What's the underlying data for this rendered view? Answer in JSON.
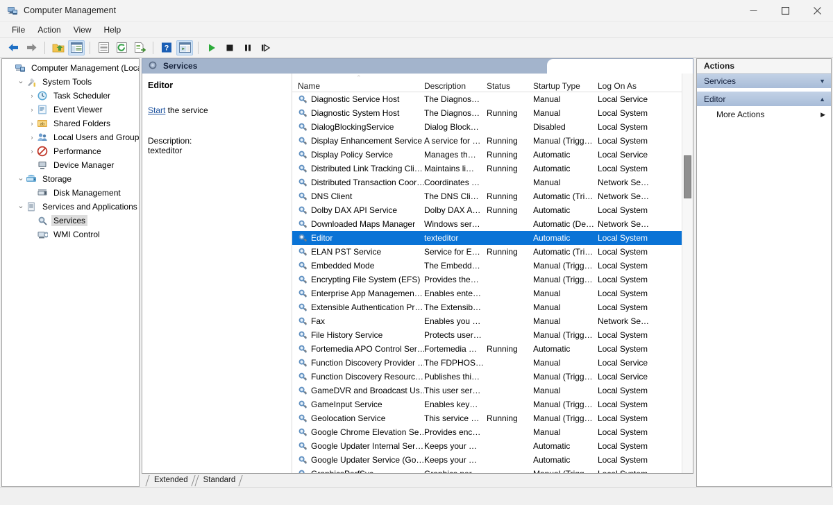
{
  "window": {
    "title": "Computer Management",
    "icon": "computer-management-icon",
    "controls": {
      "minimize": "–",
      "maximize": "❐",
      "close": "✕"
    }
  },
  "menubar": {
    "items": [
      "File",
      "Action",
      "View",
      "Help"
    ]
  },
  "toolbar": {
    "buttons": [
      {
        "name": "back-arrow-icon",
        "glyph": "←"
      },
      {
        "name": "forward-arrow-icon",
        "glyph": "→"
      },
      {
        "name": "up-one-level-icon",
        "glyph": "folder-up"
      },
      {
        "name": "show-hide-console-tree-icon",
        "glyph": "tree",
        "pressed": true
      },
      {
        "name": "properties-icon",
        "glyph": "props"
      },
      {
        "name": "refresh-icon",
        "glyph": "refresh"
      },
      {
        "name": "export-list-icon",
        "glyph": "export"
      },
      {
        "name": "help-icon",
        "glyph": "?"
      },
      {
        "name": "show-hide-action-pane-icon",
        "glyph": "actionpane",
        "pressed": true
      },
      {
        "name": "start-service-icon",
        "glyph": "▶"
      },
      {
        "name": "stop-service-icon",
        "glyph": "■"
      },
      {
        "name": "pause-service-icon",
        "glyph": "‖"
      },
      {
        "name": "restart-service-icon",
        "glyph": "▮▶"
      }
    ]
  },
  "sidebar": {
    "items": [
      {
        "label": "Computer Management (Local)",
        "indent": 0,
        "twist": "",
        "icon": "computer-icon",
        "selected": false
      },
      {
        "label": "System Tools",
        "indent": 1,
        "twist": "⌄",
        "icon": "system-tools-icon",
        "selected": false
      },
      {
        "label": "Task Scheduler",
        "indent": 2,
        "twist": "›",
        "icon": "task-scheduler-icon",
        "selected": false
      },
      {
        "label": "Event Viewer",
        "indent": 2,
        "twist": "›",
        "icon": "event-viewer-icon",
        "selected": false
      },
      {
        "label": "Shared Folders",
        "indent": 2,
        "twist": "›",
        "icon": "shared-folders-icon",
        "selected": false
      },
      {
        "label": "Local Users and Groups",
        "indent": 2,
        "twist": "›",
        "icon": "local-users-icon",
        "selected": false
      },
      {
        "label": "Performance",
        "indent": 2,
        "twist": "›",
        "icon": "performance-icon",
        "selected": false
      },
      {
        "label": "Device Manager",
        "indent": 2,
        "twist": "",
        "icon": "device-manager-icon",
        "selected": false
      },
      {
        "label": "Storage",
        "indent": 1,
        "twist": "⌄",
        "icon": "storage-icon",
        "selected": false
      },
      {
        "label": "Disk Management",
        "indent": 2,
        "twist": "",
        "icon": "disk-management-icon",
        "selected": false
      },
      {
        "label": "Services and Applications",
        "indent": 1,
        "twist": "⌄",
        "icon": "services-apps-icon",
        "selected": false
      },
      {
        "label": "Services",
        "indent": 2,
        "twist": "",
        "icon": "services-icon",
        "selected": true
      },
      {
        "label": "WMI Control",
        "indent": 2,
        "twist": "",
        "icon": "wmi-control-icon",
        "selected": false
      }
    ]
  },
  "snapin": {
    "header": "Services",
    "icon": "services-icon"
  },
  "details": {
    "title": "Editor",
    "link": "Start",
    "link_suffix": " the service",
    "description_label": "Description:",
    "description_value": "texteditor"
  },
  "table": {
    "columns": [
      "Name",
      "Description",
      "Status",
      "Startup Type",
      "Log On As"
    ],
    "sort_indicator": "⌃",
    "rows": [
      {
        "name": "Diagnostic Service Host",
        "desc": "The Diagnos…",
        "status": "",
        "startup": "Manual",
        "logon": "Local Service",
        "selected": false
      },
      {
        "name": "Diagnostic System Host",
        "desc": "The Diagnos…",
        "status": "Running",
        "startup": "Manual",
        "logon": "Local System",
        "selected": false
      },
      {
        "name": "DialogBlockingService",
        "desc": "Dialog Block…",
        "status": "",
        "startup": "Disabled",
        "logon": "Local System",
        "selected": false
      },
      {
        "name": "Display Enhancement Service",
        "desc": "A service for …",
        "status": "Running",
        "startup": "Manual (Trigg…",
        "logon": "Local System",
        "selected": false
      },
      {
        "name": "Display Policy Service",
        "desc": "Manages th…",
        "status": "Running",
        "startup": "Automatic",
        "logon": "Local Service",
        "selected": false
      },
      {
        "name": "Distributed Link Tracking Cli…",
        "desc": "Maintains li…",
        "status": "Running",
        "startup": "Automatic",
        "logon": "Local System",
        "selected": false
      },
      {
        "name": "Distributed Transaction Coor…",
        "desc": "Coordinates …",
        "status": "",
        "startup": "Manual",
        "logon": "Network Se…",
        "selected": false
      },
      {
        "name": "DNS Client",
        "desc": "The DNS Cli…",
        "status": "Running",
        "startup": "Automatic (Tri…",
        "logon": "Network Se…",
        "selected": false
      },
      {
        "name": "Dolby DAX API Service",
        "desc": "Dolby DAX A…",
        "status": "Running",
        "startup": "Automatic",
        "logon": "Local System",
        "selected": false
      },
      {
        "name": "Downloaded Maps Manager",
        "desc": "Windows ser…",
        "status": "",
        "startup": "Automatic (De…",
        "logon": "Network Se…",
        "selected": false
      },
      {
        "name": "Editor",
        "desc": "texteditor",
        "status": "",
        "startup": "Automatic",
        "logon": "Local System",
        "selected": true
      },
      {
        "name": "ELAN PST Service",
        "desc": "Service for E…",
        "status": "Running",
        "startup": "Automatic (Tri…",
        "logon": "Local System",
        "selected": false
      },
      {
        "name": "Embedded Mode",
        "desc": "The Embedd…",
        "status": "",
        "startup": "Manual (Trigg…",
        "logon": "Local System",
        "selected": false
      },
      {
        "name": "Encrypting File System (EFS)",
        "desc": "Provides the…",
        "status": "",
        "startup": "Manual (Trigg…",
        "logon": "Local System",
        "selected": false
      },
      {
        "name": "Enterprise App Managemen…",
        "desc": "Enables ente…",
        "status": "",
        "startup": "Manual",
        "logon": "Local System",
        "selected": false
      },
      {
        "name": "Extensible Authentication Pr…",
        "desc": "The Extensib…",
        "status": "",
        "startup": "Manual",
        "logon": "Local System",
        "selected": false
      },
      {
        "name": "Fax",
        "desc": "Enables you …",
        "status": "",
        "startup": "Manual",
        "logon": "Network Se…",
        "selected": false
      },
      {
        "name": "File History Service",
        "desc": "Protects user…",
        "status": "",
        "startup": "Manual (Trigg…",
        "logon": "Local System",
        "selected": false
      },
      {
        "name": "Fortemedia APO Control Ser…",
        "desc": "Fortemedia …",
        "status": "Running",
        "startup": "Automatic",
        "logon": "Local System",
        "selected": false
      },
      {
        "name": "Function Discovery Provider …",
        "desc": "The FDPHOS…",
        "status": "",
        "startup": "Manual",
        "logon": "Local Service",
        "selected": false
      },
      {
        "name": "Function Discovery Resourc…",
        "desc": "Publishes thi…",
        "status": "",
        "startup": "Manual (Trigg…",
        "logon": "Local Service",
        "selected": false
      },
      {
        "name": "GameDVR and Broadcast Us…",
        "desc": "This user ser…",
        "status": "",
        "startup": "Manual",
        "logon": "Local System",
        "selected": false
      },
      {
        "name": "GameInput Service",
        "desc": "Enables key…",
        "status": "",
        "startup": "Manual (Trigg…",
        "logon": "Local System",
        "selected": false
      },
      {
        "name": "Geolocation Service",
        "desc": "This service …",
        "status": "Running",
        "startup": "Manual (Trigg…",
        "logon": "Local System",
        "selected": false
      },
      {
        "name": "Google Chrome Elevation Se…",
        "desc": "Provides enc…",
        "status": "",
        "startup": "Manual",
        "logon": "Local System",
        "selected": false
      },
      {
        "name": "Google Updater Internal Ser…",
        "desc": "Keeps your …",
        "status": "",
        "startup": "Automatic",
        "logon": "Local System",
        "selected": false
      },
      {
        "name": "Google Updater Service (Go…",
        "desc": "Keeps your …",
        "status": "",
        "startup": "Automatic",
        "logon": "Local System",
        "selected": false
      },
      {
        "name": "GraphicsPerfSvc",
        "desc": "Graphics per…",
        "status": "",
        "startup": "Manual (Trigg…",
        "logon": "Local System",
        "selected": false
      }
    ]
  },
  "tabs": [
    {
      "label": "Extended",
      "active": true
    },
    {
      "label": "Standard",
      "active": false
    }
  ],
  "actions": {
    "title": "Actions",
    "groups": [
      {
        "label": "Services",
        "expanded": false,
        "chevron": "▼",
        "items": []
      },
      {
        "label": "Editor",
        "expanded": true,
        "chevron": "▲",
        "items": [
          {
            "label": "More Actions",
            "arrow": "▶"
          }
        ]
      }
    ]
  },
  "colors": {
    "selection": "#0a73d6",
    "snapin_header": "#a3b4cc",
    "action_group": "#a8bcd8",
    "link": "#1a4f9c"
  }
}
